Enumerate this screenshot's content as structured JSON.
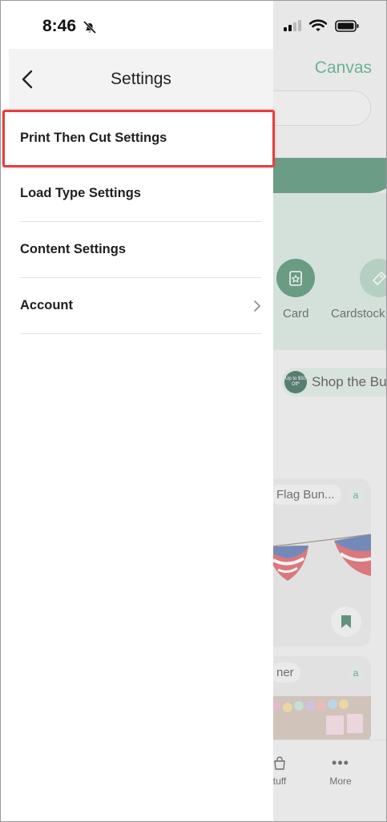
{
  "status_bar": {
    "time": "8:46"
  },
  "drawer": {
    "title": "Settings",
    "items": [
      {
        "label": "Print Then Cut Settings"
      },
      {
        "label": "Load Type Settings"
      },
      {
        "label": "Content Settings"
      },
      {
        "label": "Account"
      }
    ]
  },
  "background_app": {
    "header_title": "Canvas",
    "categories": [
      {
        "label": "Card"
      },
      {
        "label": "Cardstock"
      }
    ],
    "promo": {
      "badge_text": "Up to $50 Off*",
      "label": "Shop the Bu"
    },
    "projects": [
      {
        "title": "Flag Bun..."
      },
      {
        "title": "ner"
      }
    ],
    "tabbar": [
      {
        "label": "tuff"
      },
      {
        "label": "More"
      }
    ]
  },
  "colors": {
    "accent_green": "#2a9d6d",
    "dark_green": "#2e7a57",
    "highlight_red": "#e04040"
  }
}
